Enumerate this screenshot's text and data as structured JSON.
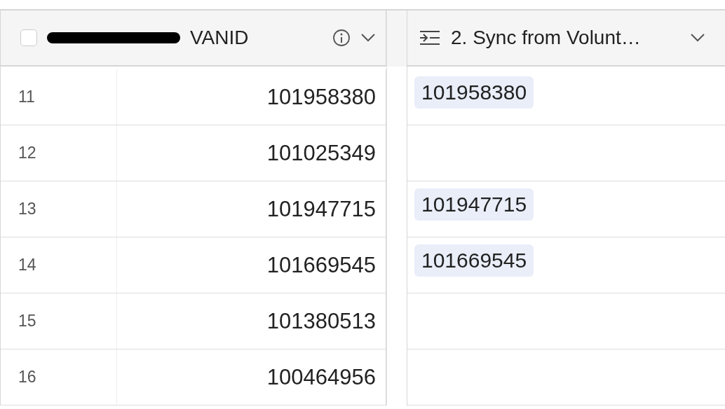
{
  "header": {
    "select_all": {
      "checked": false
    },
    "columns": [
      {
        "label": "VANID",
        "kind": "number",
        "redacted": true
      },
      {
        "label": "2. Sync from Volunt…",
        "kind": "lookup",
        "redacted": false
      }
    ]
  },
  "rows": [
    {
      "number": "11",
      "vanid": "101958380",
      "sync": "101958380"
    },
    {
      "number": "12",
      "vanid": "101025349"
    },
    {
      "number": "13",
      "vanid": "101947715",
      "sync": "101947715"
    },
    {
      "number": "14",
      "vanid": "101669545",
      "sync": "101669545"
    },
    {
      "number": "15",
      "vanid": "101380513"
    },
    {
      "number": "16",
      "vanid": "100464956"
    }
  ]
}
